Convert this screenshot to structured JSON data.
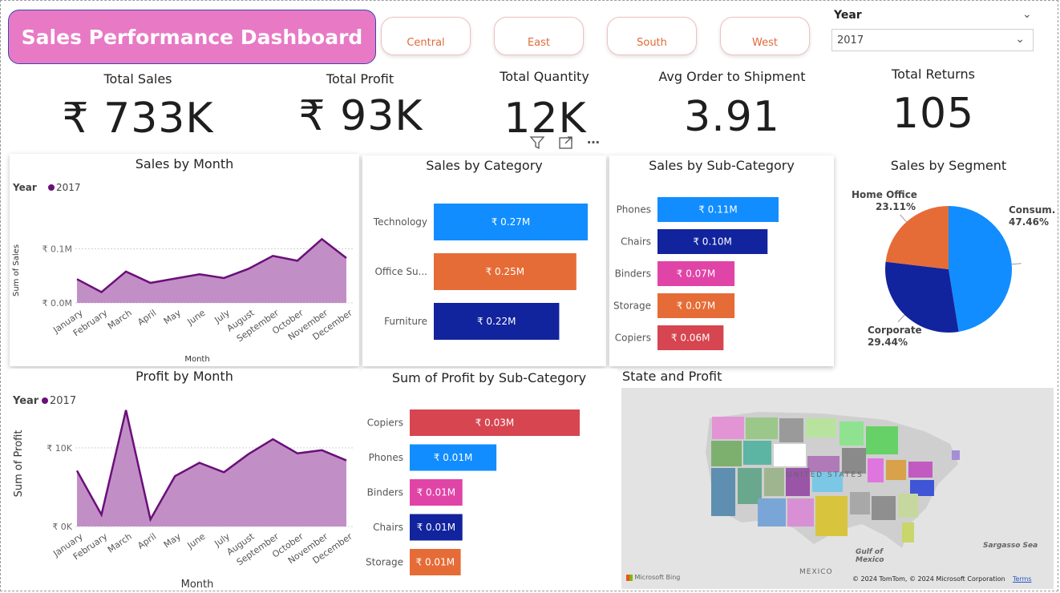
{
  "header": {
    "title": "Sales Performance Dashboard",
    "regions": [
      "Central",
      "East",
      "South",
      "West"
    ],
    "slicer": {
      "label": "Year",
      "value": "2017"
    }
  },
  "kpis": [
    {
      "label": "Total Sales",
      "value": "₹ 733K"
    },
    {
      "label": "Total Profit",
      "value": "₹ 93K"
    },
    {
      "label": "Total Quantity",
      "value": "12K"
    },
    {
      "label": "Avg Order to Shipment",
      "value": "3.91"
    },
    {
      "label": "Total Returns",
      "value": "105"
    }
  ],
  "icons": [
    "filter-icon",
    "focus-mode-icon",
    "more-options-icon"
  ],
  "chart_data": [
    {
      "id": "sales_by_month",
      "type": "area",
      "title": "Sales by Month",
      "legend": {
        "title": "Year",
        "items": [
          "2017"
        ],
        "position": "top-left"
      },
      "xlabel": "Month",
      "ylabel": "Sum of Sales",
      "ticks": [
        "₹ 0.1M",
        "₹ 0.0M"
      ],
      "ylim": [
        0,
        0.12
      ],
      "categories": [
        "January",
        "February",
        "March",
        "April",
        "May",
        "June",
        "July",
        "August",
        "September",
        "October",
        "November",
        "December"
      ],
      "series": [
        {
          "name": "2017",
          "values": [
            0.044,
            0.02,
            0.058,
            0.037,
            0.045,
            0.053,
            0.046,
            0.063,
            0.087,
            0.078,
            0.118,
            0.083
          ]
        }
      ],
      "color": "#6b0f7a"
    },
    {
      "id": "sales_by_category",
      "type": "bar",
      "title": "Sales by Category",
      "categories": [
        "Technology",
        "Office Su...",
        "Furniture"
      ],
      "values": [
        0.27,
        0.25,
        0.22
      ],
      "labels": [
        "₹ 0.27M",
        "₹ 0.25M",
        "₹ 0.22M"
      ],
      "colors": [
        "#118dff",
        "#e66c37",
        "#12239e"
      ]
    },
    {
      "id": "sales_by_subcategory",
      "type": "bar",
      "title": "Sales by Sub-Category",
      "categories": [
        "Phones",
        "Chairs",
        "Binders",
        "Storage",
        "Copiers"
      ],
      "values": [
        0.11,
        0.1,
        0.07,
        0.07,
        0.06
      ],
      "labels": [
        "₹ 0.11M",
        "₹ 0.10M",
        "₹ 0.07M",
        "₹ 0.07M",
        "₹ 0.06M"
      ],
      "colors": [
        "#118dff",
        "#12239e",
        "#e044a7",
        "#e66c37",
        "#d64550"
      ]
    },
    {
      "id": "sales_by_segment",
      "type": "pie",
      "title": "Sales by Segment",
      "categories": [
        "Consum...",
        "Corporate",
        "Home Office"
      ],
      "values": [
        47.46,
        29.44,
        23.11
      ],
      "labels": [
        "47.46%",
        "29.44%",
        "23.11%"
      ],
      "colors": [
        "#118dff",
        "#12239e",
        "#e66c37"
      ]
    },
    {
      "id": "profit_by_month",
      "type": "area",
      "title": "Profit by Month",
      "legend": {
        "title": "Year",
        "items": [
          "2017"
        ],
        "position": "top-left"
      },
      "xlabel": "Month",
      "ylabel": "Sum of Profit",
      "ticks": [
        "₹ 10K",
        "₹ 0K"
      ],
      "ylim": [
        0,
        16000
      ],
      "categories": [
        "January",
        "February",
        "March",
        "April",
        "May",
        "June",
        "July",
        "August",
        "September",
        "October",
        "November",
        "December"
      ],
      "series": [
        {
          "name": "2017",
          "values": [
            7100,
            1500,
            14800,
            900,
            6400,
            8100,
            6900,
            9200,
            11100,
            9300,
            9700,
            8400
          ]
        }
      ],
      "color": "#6b0f7a"
    },
    {
      "id": "profit_by_subcategory",
      "type": "bar",
      "title": "Sum of Profit by Sub-Category",
      "categories": [
        "Copiers",
        "Phones",
        "Binders",
        "Chairs",
        "Storage"
      ],
      "values": [
        0.03,
        0.01,
        0.01,
        0.01,
        0.01
      ],
      "labels": [
        "₹ 0.03M",
        "₹ 0.01M",
        "₹ 0.01M",
        "₹ 0.01M",
        "₹ 0.01M"
      ],
      "bar_widths_relative": [
        1.0,
        0.51,
        0.31,
        0.31,
        0.3
      ],
      "colors": [
        "#d64550",
        "#118dff",
        "#e044a7",
        "#12239e",
        "#e66c37"
      ]
    }
  ],
  "map": {
    "title": "State and Profit",
    "labels": [
      "UNITED STATES",
      "MEXICO",
      "Gulf of Mexico",
      "Sargasso Sea"
    ],
    "attribution": "© 2024 TomTom, © 2024 Microsoft Corporation",
    "terms": "Terms",
    "brand": "Microsoft Bing"
  }
}
